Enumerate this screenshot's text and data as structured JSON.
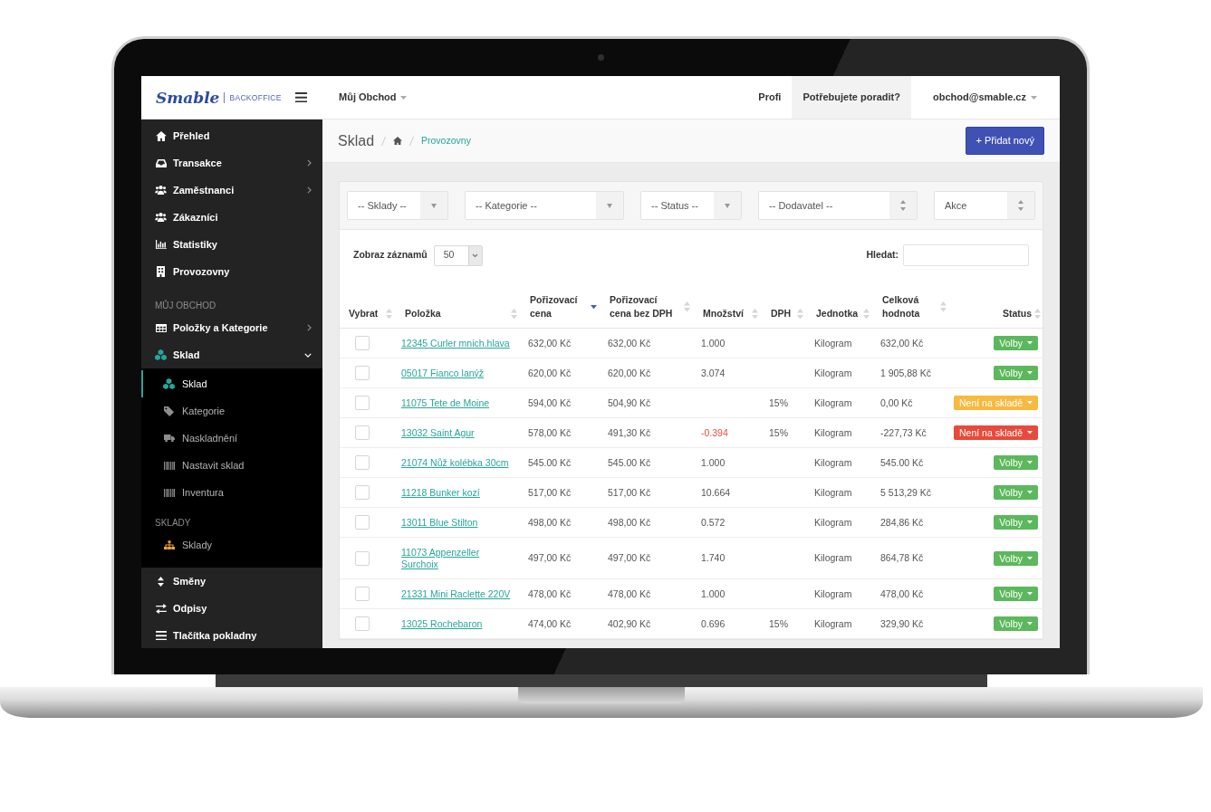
{
  "topbar": {
    "logo": "Smable",
    "logo_subtitle": "BACKOFFICE",
    "shop_menu": "Můj Obchod",
    "links": [
      {
        "label": "Profi",
        "highlighted": false
      },
      {
        "label": "Potřebujete poradit?",
        "highlighted": true
      }
    ],
    "user_menu": "obchod@smable.cz"
  },
  "sidebar": {
    "sections": [
      {
        "items": [
          {
            "label": "Přehled",
            "selected": false,
            "expandable": false,
            "expanded": false
          },
          {
            "label": "Transakce",
            "selected": false,
            "expandable": true,
            "expanded": false
          },
          {
            "label": "Zaměstnanci",
            "selected": false,
            "expandable": true,
            "expanded": false
          },
          {
            "label": "Zákazníci",
            "selected": false,
            "expandable": false,
            "expanded": false
          },
          {
            "label": "Statistiky",
            "selected": false,
            "expandable": false,
            "expanded": false
          },
          {
            "label": "Provozovny",
            "selected": false,
            "expandable": false,
            "expanded": false
          }
        ]
      },
      {
        "heading": "MŮJ OBCHOD",
        "items": [
          {
            "label": "Položky a Kategorie",
            "selected": false,
            "expandable": true,
            "expanded": false
          },
          {
            "label": "Sklad",
            "selected": true,
            "expandable": true,
            "expanded": true,
            "children": [
              {
                "kind": "link",
                "label": "Sklad",
                "selected": true
              },
              {
                "kind": "link",
                "label": "Kategorie",
                "selected": false
              },
              {
                "kind": "link",
                "label": "Naskladnění",
                "selected": false
              },
              {
                "kind": "link",
                "label": "Nastavit sklad",
                "selected": false
              },
              {
                "kind": "link",
                "label": "Inventura",
                "selected": false
              },
              {
                "kind": "heading",
                "label": "SKLADY"
              },
              {
                "kind": "link",
                "label": "Sklady",
                "selected": false
              }
            ]
          },
          {
            "label": "Směny",
            "selected": false,
            "expandable": false,
            "expanded": false
          },
          {
            "label": "Odpisy",
            "selected": false,
            "expandable": false,
            "expanded": false
          },
          {
            "label": "Tlačítka pokladny",
            "selected": false,
            "expandable": false,
            "expanded": false
          }
        ]
      }
    ]
  },
  "page_header": {
    "title": "Sklad",
    "breadcrumb": [
      "Provozovny"
    ],
    "add_button": "+ Přidat nový"
  },
  "filters": [
    {
      "value": "-- Sklady --",
      "kind": "dropdown"
    },
    {
      "value": "-- Kategorie --",
      "kind": "dropdown"
    },
    {
      "value": "-- Status --",
      "kind": "dropdown"
    },
    {
      "value": "-- Dodavatel --",
      "kind": "updown"
    },
    {
      "value": "Akce",
      "kind": "updown"
    }
  ],
  "table_controls": {
    "page_size_label": "Zobraz záznamů",
    "page_size": "50",
    "search_label": "Hledat:"
  },
  "table": {
    "columns": [
      {
        "label": "Vybrat",
        "sorted": false
      },
      {
        "label": "Položka",
        "sorted": false
      },
      {
        "label": "Pořizovací cena",
        "sorted": true
      },
      {
        "label": "Pořizovací cena bez DPH",
        "sorted": false
      },
      {
        "label": "Množství",
        "sorted": false
      },
      {
        "label": "DPH",
        "sorted": false
      },
      {
        "label": "Jednotka",
        "sorted": false
      },
      {
        "label": "Celková hodnota",
        "sorted": false
      },
      {
        "label": "Status",
        "sorted": false
      }
    ],
    "rows": [
      {
        "checked": false,
        "item": "12345 Curler mnich.hlava",
        "price": "632,00 Kč",
        "price_net": "632,00 Kč",
        "quantity": "1.000",
        "quantity_alert": false,
        "unit": "Kilogram",
        "total": "632,00 Kč",
        "status": {
          "label": "Volby",
          "color": "#5cb85c"
        }
      },
      {
        "checked": false,
        "item": "05017 Fianco lanýž",
        "price": "620,00 Kč",
        "price_net": "620,00 Kč",
        "quantity": "3.074",
        "quantity_alert": false,
        "unit": "Kilogram",
        "total": "1 905,88 Kč",
        "status": {
          "label": "Volby",
          "color": "#5cb85c"
        }
      },
      {
        "checked": false,
        "item": "11075 Tete de Moine",
        "price": "594,00 Kč",
        "price_net": "504,90 Kč",
        "vat": "15%",
        "unit": "Kilogram",
        "total": "0,00 Kč",
        "status": {
          "label": "Není na skladě",
          "color": "#f7b93e"
        }
      },
      {
        "checked": false,
        "item": "13032 Saint Agur",
        "price": "578,00 Kč",
        "price_net": "491,30 Kč",
        "quantity": "-0.394",
        "quantity_alert": true,
        "vat": "15%",
        "unit": "Kilogram",
        "total": "-227,73 Kč",
        "status": {
          "label": "Není na skladě",
          "color": "#e8493a"
        }
      },
      {
        "checked": false,
        "item": "21074 Nůž kolébka 30cm",
        "price": "545.00 Kč",
        "price_net": "545.00 Kč",
        "quantity": "1.000",
        "quantity_alert": false,
        "unit": "Kilogram",
        "total": "545.00 Kč",
        "status": {
          "label": "Volby",
          "color": "#5cb85c"
        }
      },
      {
        "checked": false,
        "item": "11218 Bunker kozí",
        "price": "517,00 Kč",
        "price_net": "517,00 Kč",
        "quantity": "10.664",
        "quantity_alert": false,
        "unit": "Kilogram",
        "total": "5 513,29 Kč",
        "status": {
          "label": "Volby",
          "color": "#5cb85c"
        }
      },
      {
        "checked": false,
        "item": "13011 Blue Stilton",
        "price": "498,00 Kč",
        "price_net": "498,00 Kč",
        "quantity": "0.572",
        "quantity_alert": false,
        "unit": "Kilogram",
        "total": "284,86 Kč",
        "status": {
          "label": "Volby",
          "color": "#5cb85c"
        }
      },
      {
        "checked": false,
        "item": "11073 Appenzeller Surchoix",
        "price": "497,00 Kč",
        "price_net": "497,00 Kč",
        "quantity": "1.740",
        "quantity_alert": false,
        "unit": "Kilogram",
        "total": "864,78 Kč",
        "status": {
          "label": "Volby",
          "color": "#5cb85c"
        }
      },
      {
        "checked": false,
        "item": "21331 Mini Raclette 220V",
        "price": "478,00 Kč",
        "price_net": "478,00 Kč",
        "quantity": "1.000",
        "quantity_alert": false,
        "unit": "Kilogram",
        "total": "478,00 Kč",
        "status": {
          "label": "Volby",
          "color": "#5cb85c"
        }
      },
      {
        "checked": false,
        "item": "13025 Rochebaron",
        "price": "474,00 Kč",
        "price_net": "402,90 Kč",
        "quantity": "0.696",
        "quantity_alert": false,
        "vat": "15%",
        "unit": "Kilogram",
        "total": "329,90 Kč",
        "status": {
          "label": "Volby",
          "color": "#5cb85c"
        }
      }
    ]
  }
}
